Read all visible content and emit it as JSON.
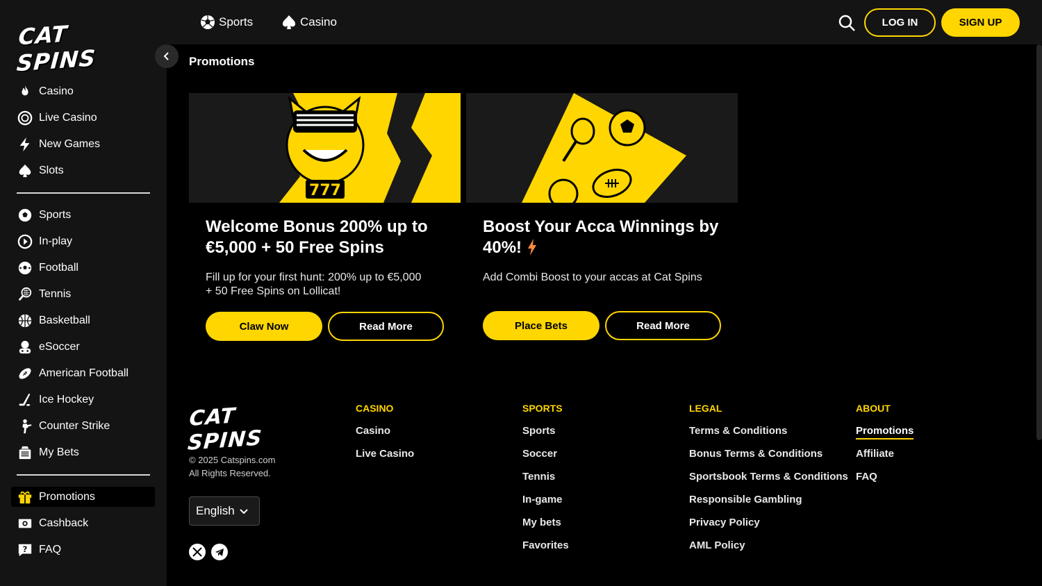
{
  "brand": {
    "name": "CAT SPINS",
    "accent": "#ffd600"
  },
  "topbar": {
    "links": [
      {
        "label": "Sports",
        "icon": "soccer-ball-icon"
      },
      {
        "label": "Casino",
        "icon": "spade-icon"
      }
    ],
    "login_label": "LOG IN",
    "signup_label": "SIGN UP"
  },
  "sidebar": {
    "group1": [
      {
        "label": "Casino",
        "icon": "flame-icon"
      },
      {
        "label": "Live Casino",
        "icon": "chip-icon"
      },
      {
        "label": "New Games",
        "icon": "lightning-icon"
      },
      {
        "label": "Slots",
        "icon": "spade-icon"
      }
    ],
    "group2": [
      {
        "label": "Sports",
        "icon": "soccer-ball-icon"
      },
      {
        "label": "In-play",
        "icon": "play-circle-icon"
      },
      {
        "label": "Football",
        "icon": "football-icon"
      },
      {
        "label": "Tennis",
        "icon": "tennis-racket-icon"
      },
      {
        "label": "Basketball",
        "icon": "basketball-icon"
      },
      {
        "label": "eSoccer",
        "icon": "gamepad-icon"
      },
      {
        "label": "American Football",
        "icon": "american-football-icon"
      },
      {
        "label": "Ice Hockey",
        "icon": "hockey-stick-icon"
      },
      {
        "label": "Counter Strike",
        "icon": "soldier-icon"
      },
      {
        "label": "My Bets",
        "icon": "bets-slip-icon"
      }
    ],
    "group3": [
      {
        "label": "Promotions",
        "icon": "gift-icon",
        "active": true
      },
      {
        "label": "Cashback",
        "icon": "cash-icon"
      },
      {
        "label": "FAQ",
        "icon": "question-icon"
      }
    ]
  },
  "main": {
    "title": "Promotions",
    "cards": [
      {
        "title": "Welcome Bonus 200% up to €5,000 + 50 Free Spins",
        "desc": "Fill up for your first hunt: 200% up to €5,000 + 50 Free Spins on Lollicat!",
        "primary": "Claw Now",
        "secondary": "Read More",
        "banner_text": "777"
      },
      {
        "title": "Boost Your Acca Winnings by 40%!",
        "desc": "Add Combi Boost to your accas at Cat Spins",
        "primary": "Place Bets",
        "secondary": "Read More"
      }
    ]
  },
  "footer": {
    "copyright_line1": "© 2025 Catspins.com",
    "copyright_line2": "All Rights Reserved.",
    "language": "English",
    "columns": [
      {
        "heading": "CASINO",
        "links": [
          "Casino",
          "Live Casino"
        ]
      },
      {
        "heading": "SPORTS",
        "links": [
          "Sports",
          "Soccer",
          "Tennis",
          "In-game",
          "My bets",
          "Favorites"
        ]
      },
      {
        "heading": "LEGAL",
        "links": [
          "Terms & Conditions",
          "Bonus Terms & Conditions",
          "Sportsbook Terms & Conditions",
          "Responsible Gambling",
          "Privacy Policy",
          "AML Policy"
        ]
      },
      {
        "heading": "ABOUT",
        "links": [
          "Promotions",
          "Affiliate",
          "FAQ"
        ]
      }
    ],
    "social": [
      "x-icon",
      "telegram-icon"
    ]
  }
}
